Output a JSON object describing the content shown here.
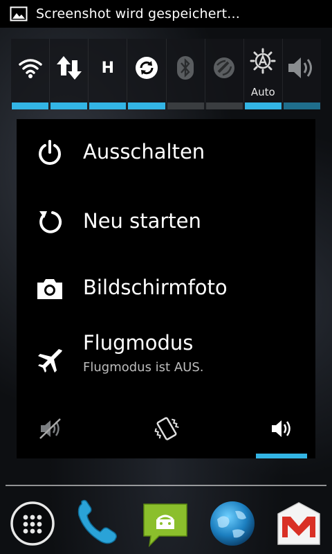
{
  "status_bar": {
    "notification_icon": "image-icon",
    "text": "Screenshot wird gespeichert..."
  },
  "quick_toggles": [
    {
      "name": "wifi",
      "icon": "wifi-icon",
      "state": "on",
      "label": ""
    },
    {
      "name": "mobile-data",
      "icon": "data-arrows-icon",
      "state": "on",
      "label": ""
    },
    {
      "name": "network-mode",
      "icon": "h-icon",
      "state": "on",
      "label": "",
      "glyph": "H"
    },
    {
      "name": "sync",
      "icon": "sync-icon",
      "state": "on",
      "label": ""
    },
    {
      "name": "bluetooth",
      "icon": "bluetooth-icon",
      "state": "off",
      "label": ""
    },
    {
      "name": "gps",
      "icon": "gps-icon",
      "state": "off",
      "label": ""
    },
    {
      "name": "brightness",
      "icon": "brightness-auto-icon",
      "state": "on",
      "label": "Auto"
    },
    {
      "name": "volume",
      "icon": "volume-icon",
      "state": "half",
      "label": ""
    }
  ],
  "power_menu": {
    "items": [
      {
        "icon": "power-icon",
        "label": "Ausschalten"
      },
      {
        "icon": "restart-icon",
        "label": "Neu starten"
      },
      {
        "icon": "camera-icon",
        "label": "Bildschirmfoto"
      },
      {
        "icon": "airplane-icon",
        "label": "Flugmodus",
        "sublabel": "Flugmodus ist AUS."
      }
    ],
    "sound_modes": [
      {
        "icon": "silent-icon",
        "selected": false
      },
      {
        "icon": "vibrate-icon",
        "selected": false
      },
      {
        "icon": "sound-on-icon",
        "selected": true
      }
    ]
  },
  "dock": {
    "apps": [
      {
        "icon": "app-drawer-icon"
      },
      {
        "icon": "phone-icon"
      },
      {
        "icon": "messaging-icon"
      },
      {
        "icon": "browser-globe-icon"
      },
      {
        "icon": "gmail-icon"
      }
    ]
  },
  "colors": {
    "accent": "#33b5e5",
    "toggle_off": "#3a3d40",
    "menu_bg": "#000000"
  }
}
